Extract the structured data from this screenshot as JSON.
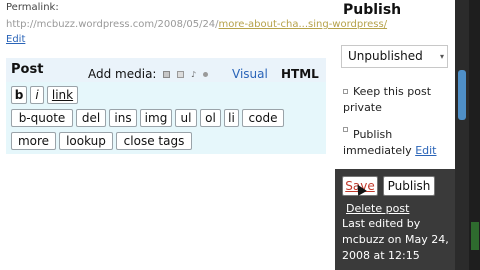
{
  "permalink": {
    "label": "Permalink:",
    "url_prefix": "http://mcbuzz.wordpress.com/2008/05/24/",
    "url_slug": "more-about-cha...sing-wordpress/",
    "edit": "Edit"
  },
  "post": {
    "title": "Post",
    "add_media_label": "Add media:",
    "tab_visual": "Visual",
    "tab_html": "HTML",
    "buttons": [
      "b",
      "i",
      "link",
      "b-quote",
      "del",
      "ins",
      "img",
      "ul",
      "ol",
      "li",
      "code",
      "more",
      "lookup",
      "close tags"
    ]
  },
  "publish": {
    "heading": "Publish",
    "status_value": "Unpublished",
    "keep_private_label": "Keep this post private",
    "publish_label": "Publish immediately",
    "publish_edit": "Edit",
    "save_label": "Save",
    "publish_button_label": "Publish",
    "delete_label": "Delete post",
    "last_edited": "Last edited by mcbuzz on May 24, 2008 at 12:15"
  },
  "colors": {
    "link": "#2a64b8",
    "slug": "#b6a24a",
    "panel_bg": "#eaf3fa",
    "dark_box": "#3a3a3a"
  }
}
